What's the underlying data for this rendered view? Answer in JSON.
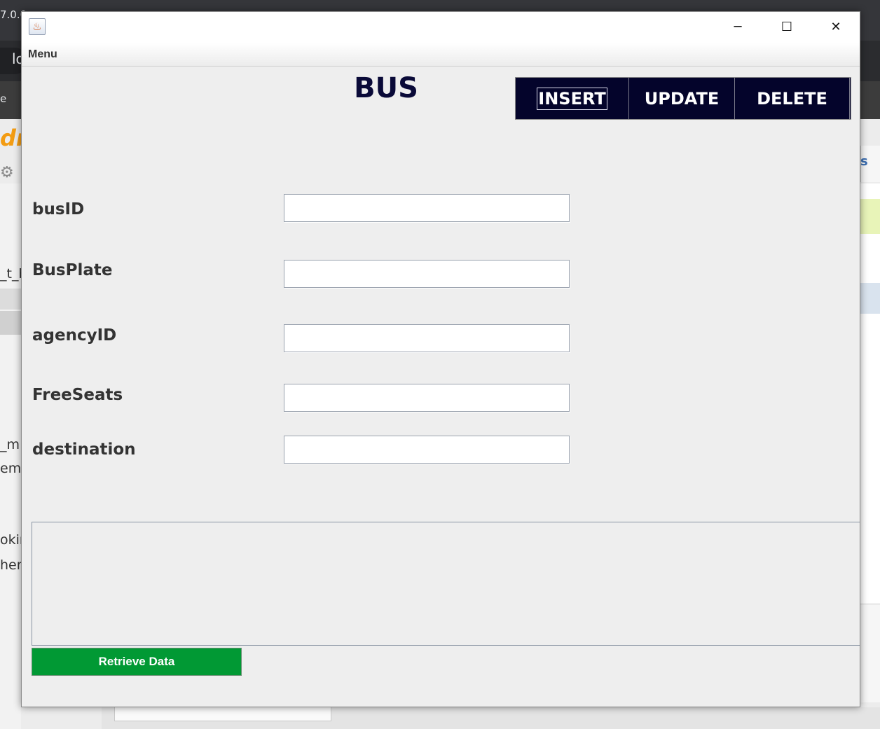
{
  "background": {
    "tab_fragment": "7.0.0",
    "omnibox_fragment": "lo",
    "bookmark_fragment": "e",
    "logo_fragment": "dr",
    "left_fragments": [
      "_t_b",
      "_m",
      "ema",
      "okir",
      "hem"
    ],
    "right_tab_fragment": "s"
  },
  "window": {
    "icon": "java-icon",
    "controls": {
      "minimize": "─",
      "maximize": "☐",
      "close": "✕"
    }
  },
  "menubar": {
    "menu_label": "Menu"
  },
  "form": {
    "title": "BUS",
    "actions": {
      "insert": "INSERT",
      "update": "UPDATE",
      "delete": "DELETE"
    },
    "fields": [
      {
        "label": "busID",
        "value": ""
      },
      {
        "label": "BusPlate",
        "value": ""
      },
      {
        "label": "agencyID",
        "value": ""
      },
      {
        "label": "FreeSeats",
        "value": ""
      },
      {
        "label": "destination",
        "value": ""
      }
    ],
    "retrieve_label": "Retrieve Data"
  },
  "colors": {
    "title_text": "#0a0a38",
    "action_bar": "#04042b",
    "retrieve_button": "#019934",
    "window_bg": "#eeeeee"
  }
}
